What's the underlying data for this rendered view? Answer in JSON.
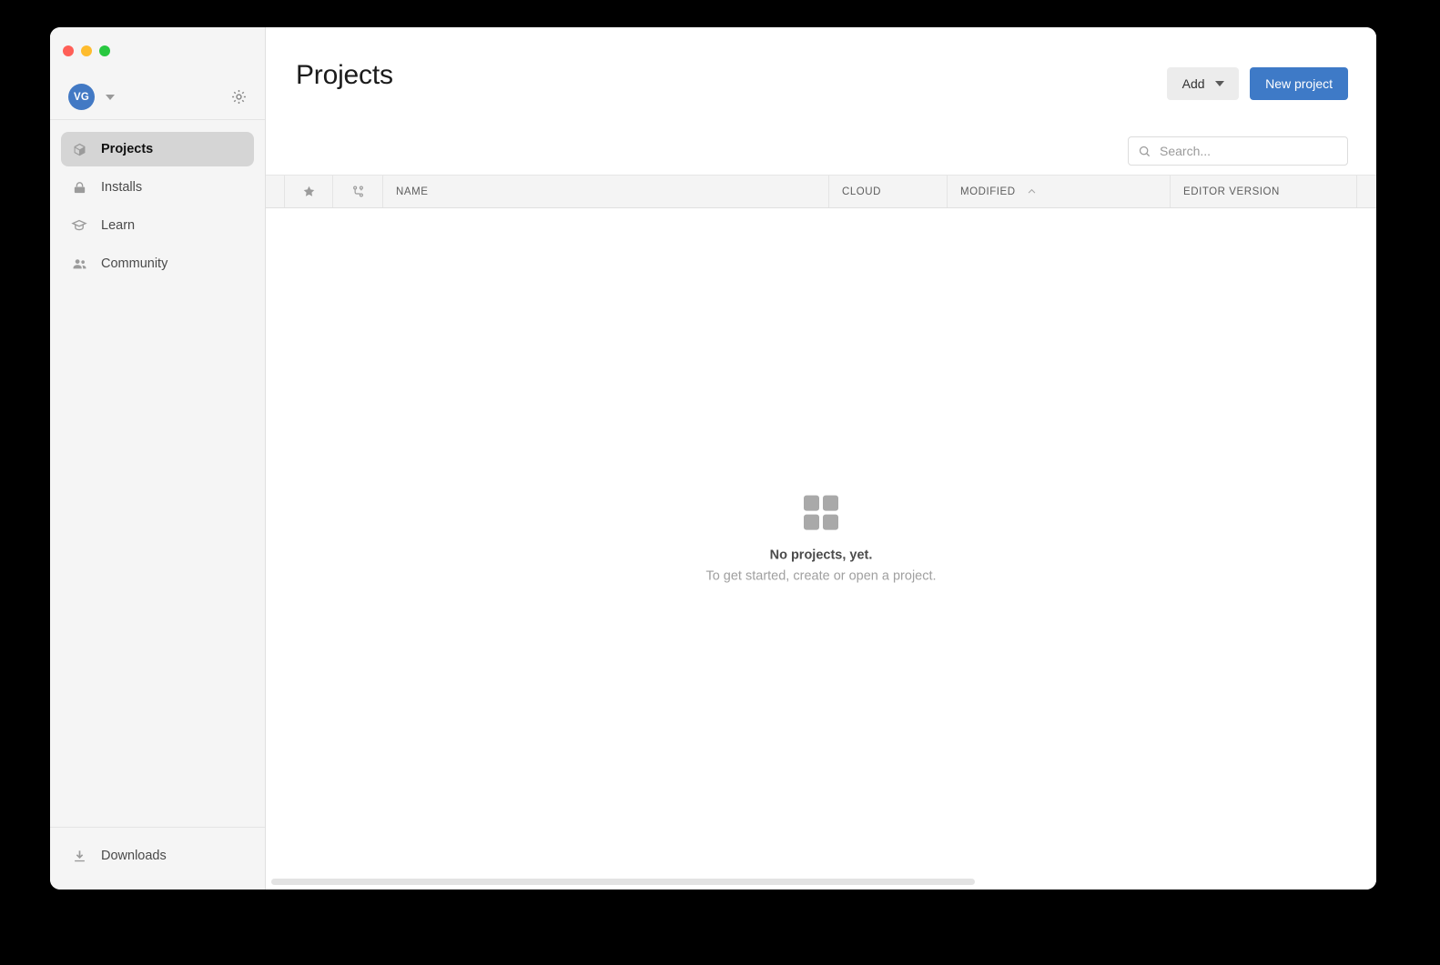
{
  "window": {
    "traffic_lights": [
      {
        "name": "close",
        "color": "#ff5f57"
      },
      {
        "name": "minimize",
        "color": "#febc2e"
      },
      {
        "name": "zoom",
        "color": "#28c840"
      }
    ]
  },
  "sidebar": {
    "account": {
      "initials": "VG",
      "dropdown_icon": "chevron-down-icon",
      "settings_icon": "gear-icon"
    },
    "items": [
      {
        "label": "Projects",
        "icon": "cube-icon",
        "active": true
      },
      {
        "label": "Installs",
        "icon": "lock-icon",
        "active": false
      },
      {
        "label": "Learn",
        "icon": "graduation-cap-icon",
        "active": false
      },
      {
        "label": "Community",
        "icon": "people-icon",
        "active": false
      }
    ],
    "footer": {
      "label": "Downloads",
      "icon": "download-icon"
    }
  },
  "header": {
    "title": "Projects",
    "add_button": "Add",
    "new_project_button": "New project",
    "accent_color": "#3e7ac7",
    "add_button_color": "#ececec"
  },
  "search": {
    "value": "",
    "placeholder": "Search...",
    "icon": "search-icon"
  },
  "table": {
    "columns": [
      {
        "key": "drag",
        "label": "",
        "icon": null
      },
      {
        "key": "star",
        "label": "",
        "icon": "star-icon"
      },
      {
        "key": "vcs",
        "label": "",
        "icon": "version-control-icon"
      },
      {
        "key": "name",
        "label": "NAME",
        "icon": null
      },
      {
        "key": "cloud",
        "label": "CLOUD",
        "icon": null
      },
      {
        "key": "modified",
        "label": "MODIFIED",
        "icon": "sort-ascending-icon",
        "sorted": "asc"
      },
      {
        "key": "editor",
        "label": "EDITOR VERSION",
        "icon": null
      },
      {
        "key": "tail",
        "label": "",
        "icon": null
      }
    ],
    "rows": []
  },
  "empty_state": {
    "title": "No projects, yet.",
    "subtitle": "To get started, create or open a project.",
    "icon": "grid-placeholder-icon"
  },
  "scrollbar": {
    "orientation": "horizontal",
    "thumb_percent": 64
  }
}
